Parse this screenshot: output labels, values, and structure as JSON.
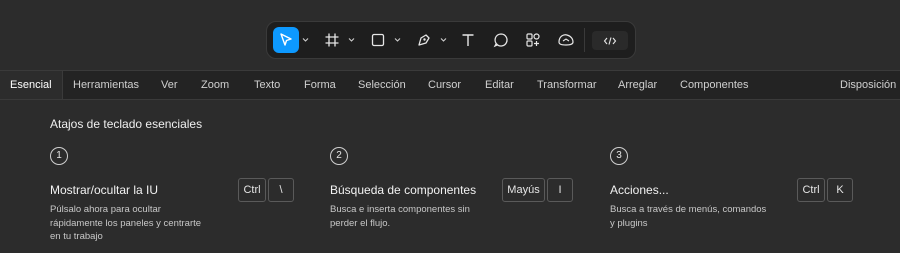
{
  "toolbar": {
    "tools": [
      {
        "icon": "move-cursor-icon",
        "has_dropdown": true,
        "active": true
      },
      {
        "icon": "frame-icon",
        "has_dropdown": true
      },
      {
        "icon": "rectangle-icon",
        "has_dropdown": true
      },
      {
        "icon": "pen-icon",
        "has_dropdown": true
      },
      {
        "icon": "text-icon"
      },
      {
        "icon": "comment-icon"
      },
      {
        "icon": "actions-icon"
      },
      {
        "icon": "figjam-icon"
      },
      {
        "icon": "dev-mode-icon"
      }
    ],
    "accent_color": "#0d99ff"
  },
  "tabs": [
    {
      "label": "Esencial",
      "active": true
    },
    {
      "label": "Herramientas"
    },
    {
      "label": "Ver"
    },
    {
      "label": "Zoom"
    },
    {
      "label": "Texto"
    },
    {
      "label": "Forma"
    },
    {
      "label": "Selección"
    },
    {
      "label": "Cursor"
    },
    {
      "label": "Editar"
    },
    {
      "label": "Transformar"
    },
    {
      "label": "Arreglar"
    },
    {
      "label": "Componentes"
    },
    {
      "label": "Disposición"
    }
  ],
  "section": {
    "title": "Atajos de teclado esenciales",
    "items": [
      {
        "number": "1",
        "title": "Mostrar/ocultar la IU",
        "description_lines": [
          "Púlsalo ahora para ocultar",
          "rápidamente los paneles y centrarte",
          "en tu trabajo"
        ],
        "keys": [
          "Ctrl",
          "\\"
        ]
      },
      {
        "number": "2",
        "title": "Búsqueda de componentes",
        "description_lines": [
          "Busca e inserta componentes sin",
          "perder el flujo."
        ],
        "keys": [
          "Mayús",
          "I"
        ]
      },
      {
        "number": "3",
        "title": "Acciones...",
        "description_lines": [
          "Busca a través de menús, comandos",
          "y plugins"
        ],
        "keys": [
          "Ctrl",
          "K"
        ]
      }
    ]
  }
}
